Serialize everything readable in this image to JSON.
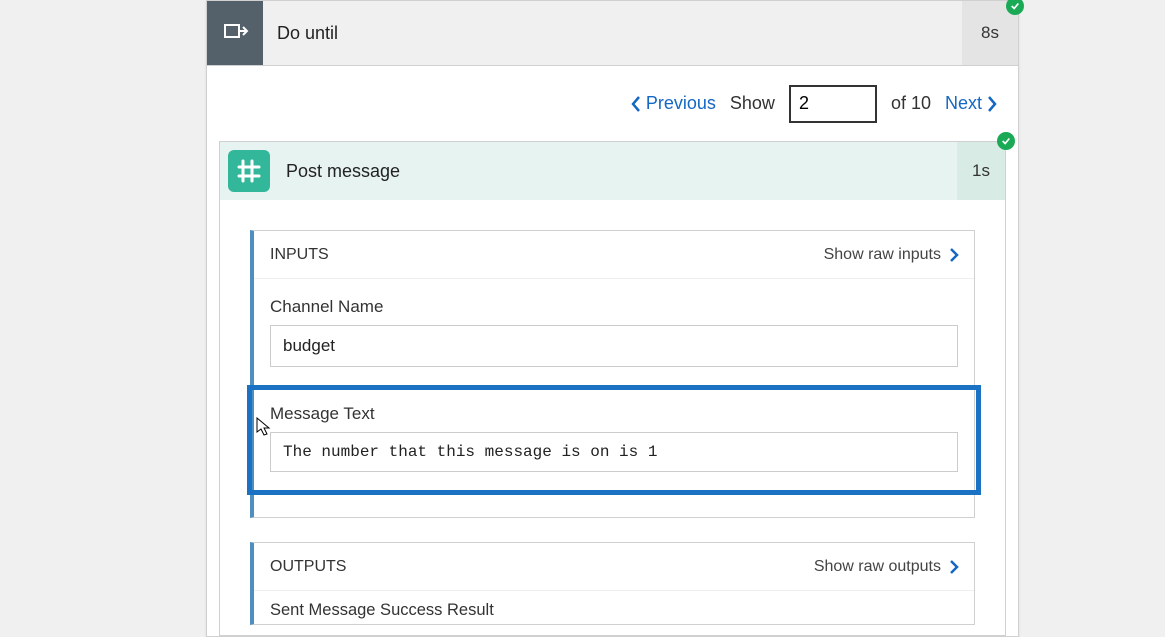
{
  "doUntil": {
    "title": "Do until",
    "duration": "8s"
  },
  "pager": {
    "previous": "Previous",
    "showLabel": "Show",
    "showValue": "2",
    "ofText": "of 10",
    "next": "Next"
  },
  "postMessage": {
    "title": "Post message",
    "duration": "1s"
  },
  "inputs": {
    "heading": "INPUTS",
    "rawLink": "Show raw inputs",
    "channelName": {
      "label": "Channel Name",
      "value": "budget"
    },
    "messageText": {
      "label": "Message Text",
      "value": "The number that this message is on is 1"
    }
  },
  "outputs": {
    "heading": "OUTPUTS",
    "rawLink": "Show raw outputs",
    "sentResult": {
      "label": "Sent Message Success Result"
    }
  }
}
